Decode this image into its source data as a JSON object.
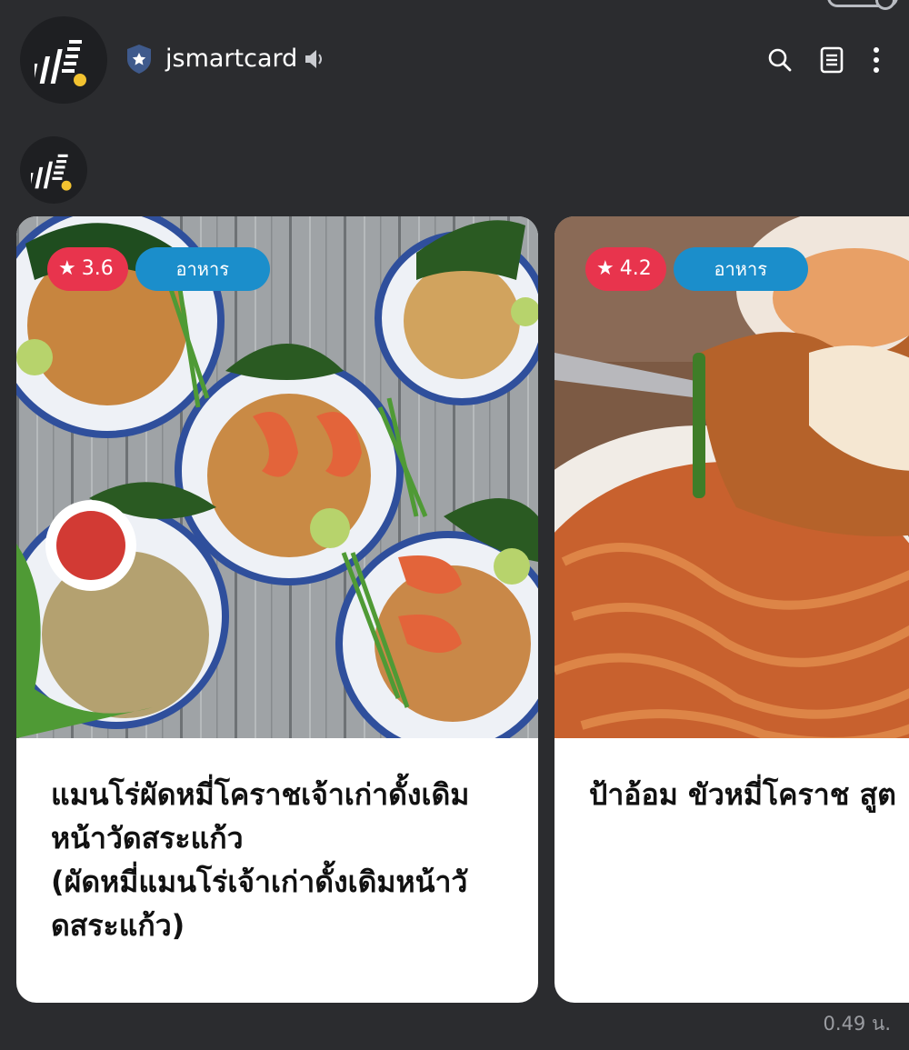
{
  "header": {
    "account_name": "jsmartcard",
    "icons": [
      "search-icon",
      "notes-icon",
      "more-vert-icon"
    ]
  },
  "cards": [
    {
      "rating": "3.6",
      "category": "อาหาร",
      "title": "แมนโร่ผัดหมี่โคราชเจ้าเก่าดั้งเดิม\nหน้าวัดสระแก้ว\n(ผัดหมี่แมนโร่เจ้าเก่าดั้งเดิมหน้าวั\nดสระแก้ว)"
    },
    {
      "rating": "4.2",
      "category": "อาหาร",
      "title": "ป้าอ้อม ขัวหมี่โคราช สูต"
    }
  ],
  "message": {
    "timestamp": "0.49 น."
  },
  "colors": {
    "background": "#2b2c2f",
    "rating_badge": "#e8344d",
    "category_badge": "#1b8ecb"
  }
}
